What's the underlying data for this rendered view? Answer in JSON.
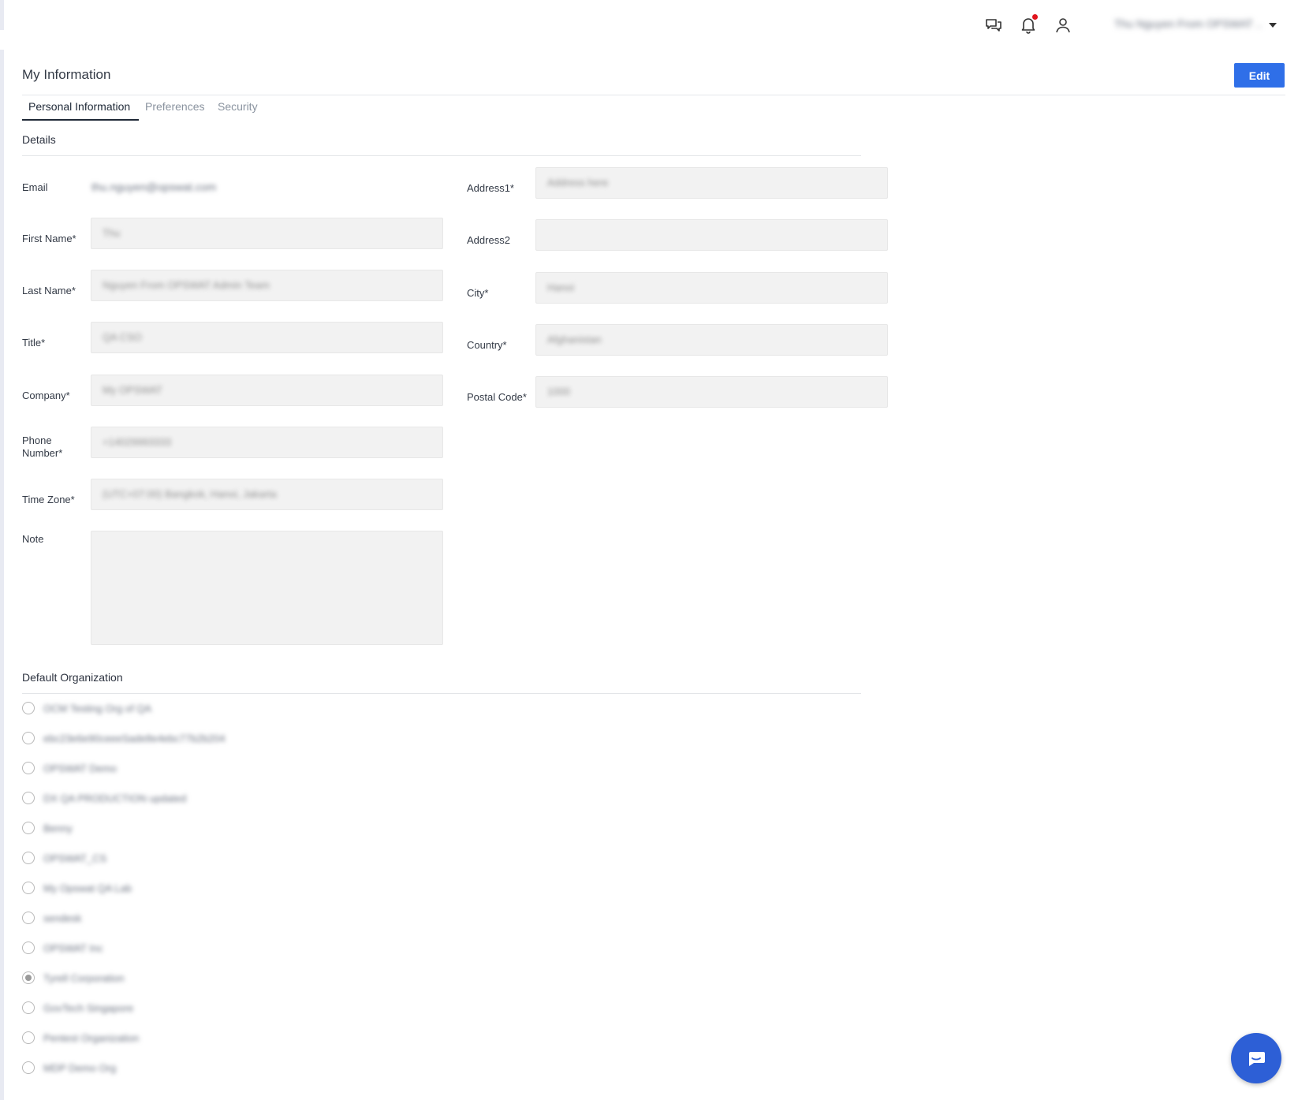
{
  "topbar": {
    "icons": [
      "chat-bubbles-icon",
      "bell-icon",
      "user-icon",
      "caret-down-icon"
    ],
    "notification_dot_color": "#e1131c",
    "user_name": "Thu Nguyen From OPSWAT ..."
  },
  "page": {
    "title": "My Information",
    "edit_label": "Edit",
    "accent_color": "#2f6fe8"
  },
  "tabs": [
    {
      "label": "Personal Information",
      "active": true
    },
    {
      "label": "Preferences",
      "active": false
    },
    {
      "label": "Security",
      "active": false
    }
  ],
  "details": {
    "section_title": "Details",
    "email": {
      "label": "Email",
      "value": "thu.nguyen@opswat.com"
    },
    "first_name": {
      "label": "First Name*",
      "value": "Thu"
    },
    "last_name": {
      "label": "Last Name*",
      "value": "Nguyen From OPSWAT Admin Team"
    },
    "title": {
      "label": "Title*",
      "value": "QA CSO"
    },
    "company": {
      "label": "Company*",
      "value": "My OPSWAT"
    },
    "phone_label_line1": "Phone",
    "phone_label_line2": "Number*",
    "phone": {
      "value": "+14029993333"
    },
    "time_zone": {
      "label": "Time Zone*",
      "value": "(UTC+07:00) Bangkok, Hanoi, Jakarta"
    },
    "note": {
      "label": "Note",
      "value": ""
    },
    "address1": {
      "label": "Address1*",
      "value": "Address here"
    },
    "address2": {
      "label": "Address2",
      "value": ""
    },
    "city": {
      "label": "City*",
      "value": "Hanoi"
    },
    "country": {
      "label": "Country*",
      "value": "Afghanistan"
    },
    "postal_code": {
      "label": "Postal Code*",
      "value": "1000"
    }
  },
  "default_org": {
    "section_title": "Default Organization",
    "items": [
      {
        "label": "OCM Testing Org of QA",
        "checked": false
      },
      {
        "label": "ebc23e6e90ceeeSade8e4ebc77b2b204",
        "checked": false
      },
      {
        "label": "OPSWAT Demo",
        "checked": false
      },
      {
        "label": "DX QA PRODUCTION updated",
        "checked": false
      },
      {
        "label": "Benny",
        "checked": false
      },
      {
        "label": "OPSWAT_CS",
        "checked": false
      },
      {
        "label": "My Opswat QA Lab",
        "checked": false
      },
      {
        "label": "sendesk",
        "checked": false
      },
      {
        "label": "OPSWAT Inc",
        "checked": false
      },
      {
        "label": "Tyrell Corporation",
        "checked": true
      },
      {
        "label": "GovTech Singapore",
        "checked": false
      },
      {
        "label": "Pentest Organization",
        "checked": false
      },
      {
        "label": "MDP Demo Org",
        "checked": false
      }
    ]
  },
  "chat_fab": {
    "icon": "chat-bubble-icon",
    "color": "#2d5fd6"
  }
}
